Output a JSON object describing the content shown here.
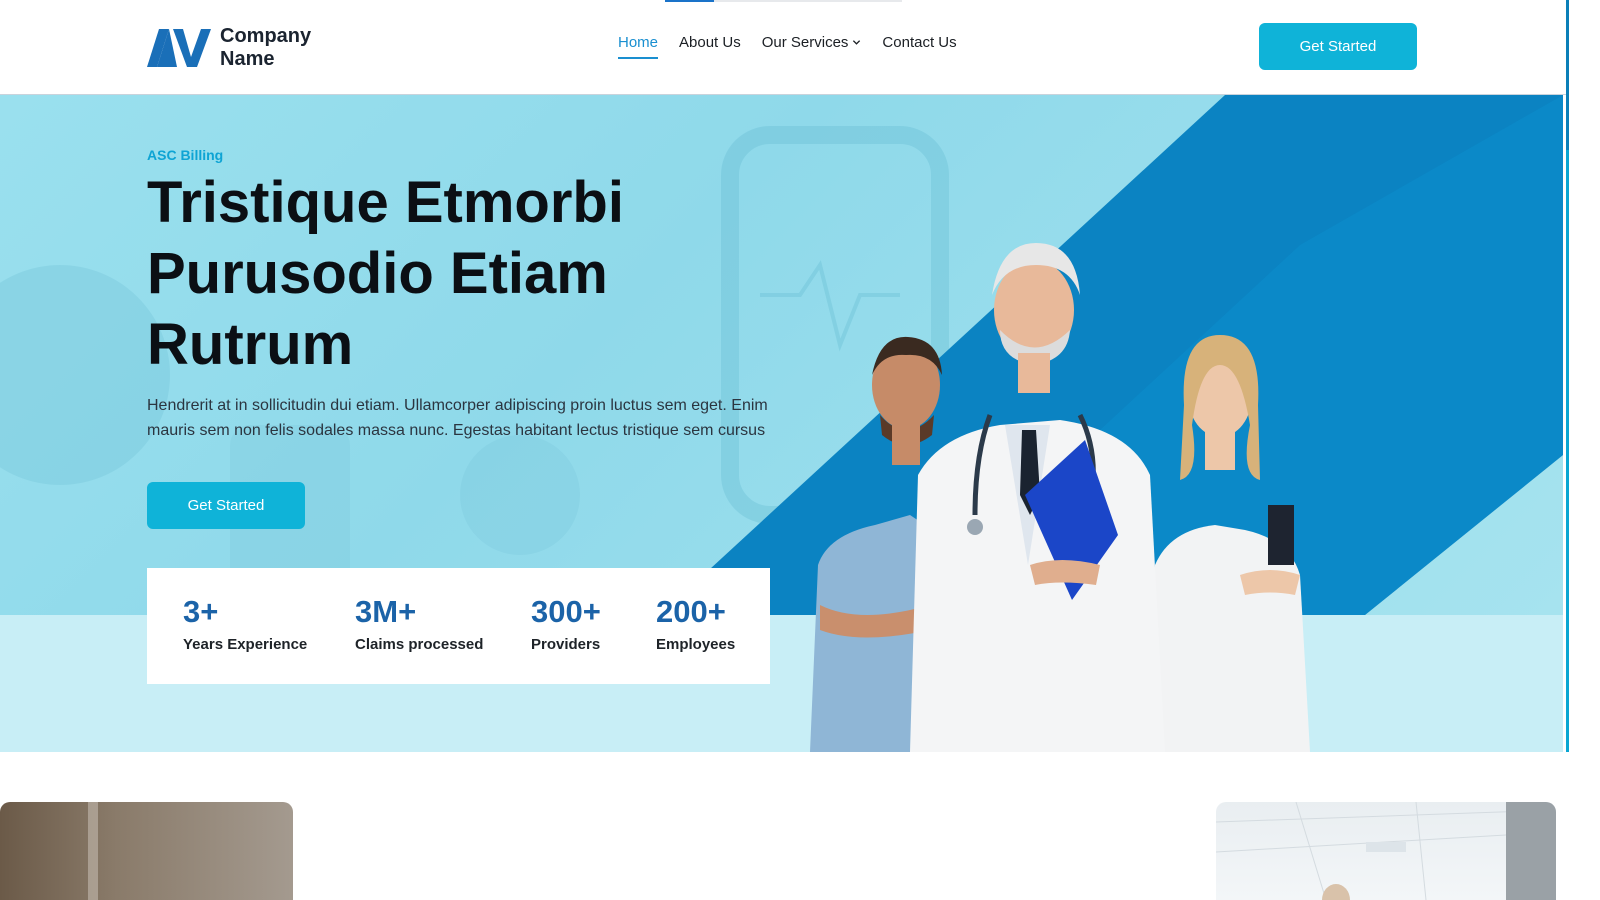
{
  "brand": {
    "name_line1": "Company",
    "name_line2": "Name",
    "color": "#1a6fb8"
  },
  "nav": {
    "items": [
      {
        "label": "Home",
        "active": true
      },
      {
        "label": "About Us",
        "active": false
      },
      {
        "label": "Our Services",
        "active": false,
        "has_dropdown": true
      },
      {
        "label": "Contact Us",
        "active": false
      }
    ],
    "accent": "#1a8fd0"
  },
  "header": {
    "cta_label": "Get Started"
  },
  "hero": {
    "eyebrow": "ASC Billing",
    "title_line1": "Tristique Etmorbi",
    "title_line2": "Purusodio Etiam",
    "title_line3": "Rutrum",
    "description": "Hendrerit at in sollicitudin dui etiam. Ullamcorper adipiscing proin luctus sem eget. Enim mauris sem non felis sodales massa nunc. Egestas habitant lectus tristique sem cursus",
    "cta_label": "Get Started"
  },
  "stats": [
    {
      "value": "3+",
      "label": "Years Experience"
    },
    {
      "value": "3M+",
      "label": "Claims processed"
    },
    {
      "value": "300+",
      "label": "Providers"
    },
    {
      "value": "200+",
      "label": "Employees"
    }
  ],
  "colors": {
    "button": "#0fb3d8",
    "stat_value": "#1b63a8",
    "diagonal": "#0b7fbc"
  }
}
